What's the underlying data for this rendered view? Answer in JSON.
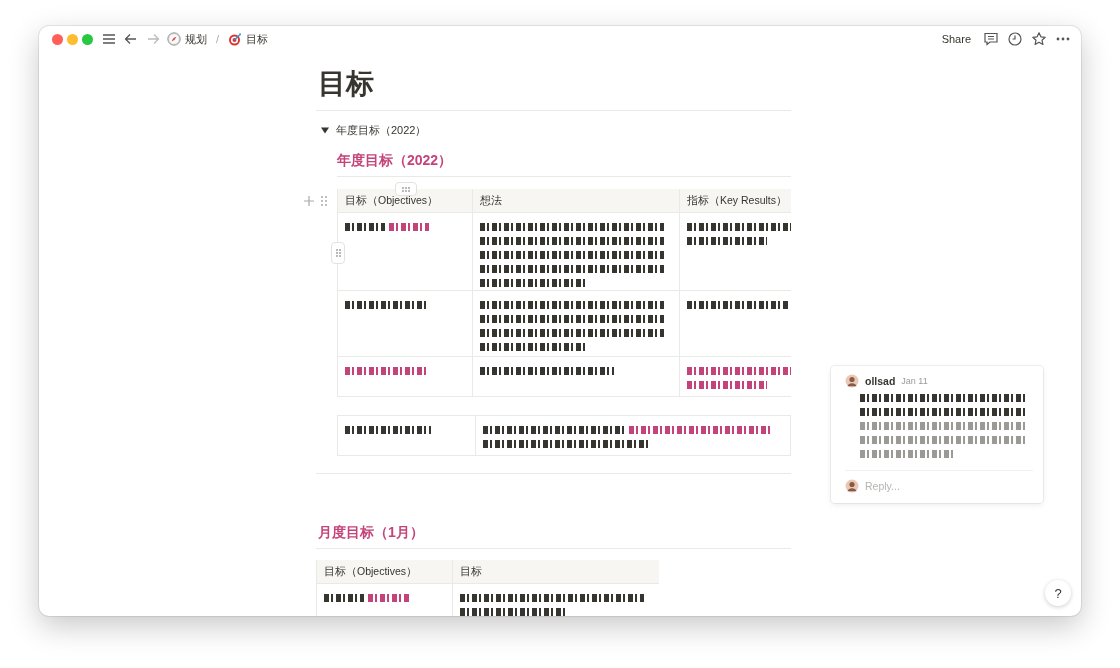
{
  "breadcrumb_separator": "/",
  "breadcrumb": [
    {
      "kind": "compass",
      "label": "规划"
    },
    {
      "kind": "target",
      "label": "目标"
    }
  ],
  "toolbar": {
    "share": "Share",
    "icons": [
      {
        "kind": "comment"
      },
      {
        "kind": "history"
      },
      {
        "kind": "star"
      },
      {
        "kind": "more"
      }
    ]
  },
  "page": {
    "title": "目标",
    "toggle": {
      "label": "年度目标（2022）",
      "expanded": true,
      "heading": "年度目标（2022）",
      "table": {
        "columns": [
          "目标（Objectives）",
          "想法",
          "指标（Key Results）"
        ],
        "rows": [
          {
            "cells": [
              {
                "lines": [
                  [
                    {
                      "color": "#37352f"
                    },
                    {
                      "color": "#c4437a"
                    }
                  ]
                ]
              },
              {
                "lines": [
                  [
                    {
                      "color": "#37352f"
                    }
                  ],
                  [
                    {
                      "color": "#37352f"
                    }
                  ],
                  [
                    {
                      "color": "#37352f"
                    }
                  ],
                  [
                    {
                      "color": "#37352f"
                    }
                  ],
                  [
                    {
                      "color": "#37352f"
                    }
                  ]
                ]
              },
              {
                "lines": [
                  [
                    {
                      "color": "#37352f"
                    }
                  ],
                  [
                    {
                      "color": "#37352f"
                    }
                  ]
                ]
              }
            ]
          },
          {
            "cells": [
              {
                "lines": [
                  [
                    {
                      "color": "#37352f"
                    }
                  ]
                ]
              },
              {
                "lines": [
                  [
                    {
                      "color": "#37352f"
                    }
                  ],
                  [
                    {
                      "color": "#37352f"
                    }
                  ],
                  [
                    {
                      "color": "#37352f"
                    }
                  ],
                  [
                    {
                      "color": "#37352f"
                    }
                  ]
                ]
              },
              {
                "lines": [
                  [
                    {
                      "color": "#37352f"
                    }
                  ]
                ]
              }
            ]
          },
          {
            "cells": [
              {
                "lines": [
                  [
                    {
                      "color": "#c4437a"
                    }
                  ]
                ]
              },
              {
                "lines": [
                  [
                    {
                      "color": "#37352f"
                    }
                  ]
                ]
              },
              {
                "lines": [
                  [
                    {
                      "color": "#c4437a"
                    }
                  ],
                  [
                    {
                      "color": "#c4437a"
                    }
                  ]
                ]
              }
            ]
          }
        ]
      },
      "extra_row": {
        "cells": [
          {
            "lines": [
              [
                {
                  "color": "#37352f"
                }
              ]
            ]
          },
          {
            "lines": [
              [
                {
                  "color": "#37352f"
                },
                {
                  "color": "#c4437a"
                }
              ],
              [
                {
                  "color": "#37352f"
                }
              ]
            ]
          }
        ]
      }
    },
    "section": {
      "heading": "月度目标（1月）",
      "table": {
        "columns": [
          "目标（Objectives）",
          "目标"
        ],
        "rows": [
          {
            "cells": [
              {
                "lines": [
                  [
                    {
                      "color": "#37352f"
                    },
                    {
                      "color": "#c4437a"
                    }
                  ]
                ]
              },
              {
                "lines": [
                  [
                    {
                      "color": "#37352f"
                    }
                  ],
                  [
                    {
                      "color": "#37352f"
                    }
                  ]
                ]
              }
            ]
          }
        ]
      }
    }
  },
  "comment": {
    "author": "ollsad",
    "date": "Jan 11",
    "lines": [
      [
        {
          "color": "#37352f"
        }
      ],
      [
        {
          "color": "#37352f"
        }
      ],
      [
        {
          "color": "#9b9a97"
        }
      ],
      [
        {
          "color": "#9b9a97"
        }
      ],
      [
        {
          "color": "#9b9a97"
        }
      ]
    ],
    "reply_placeholder": "Reply..."
  },
  "help": "?"
}
